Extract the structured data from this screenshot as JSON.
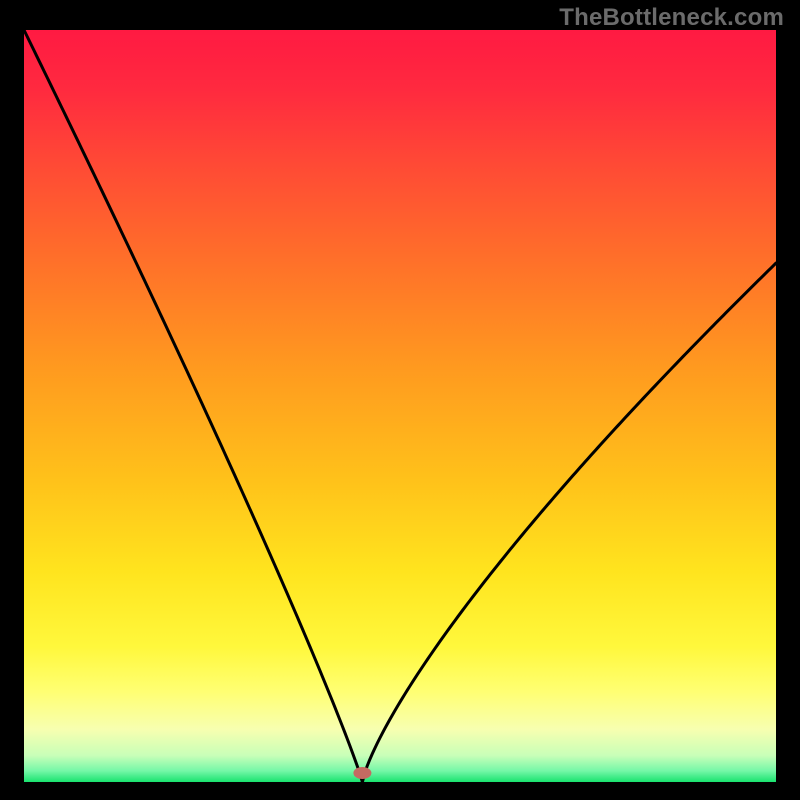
{
  "watermark": "TheBottleneck.com",
  "chart_data": {
    "type": "line",
    "title": "",
    "xlabel": "",
    "ylabel": "",
    "xlim": [
      0,
      100
    ],
    "ylim": [
      0,
      100
    ],
    "optimum_x": 45,
    "marker": {
      "x": 45,
      "y": 1.2,
      "color": "#c46a62",
      "rx": 9,
      "ry": 6
    },
    "gradient_stops": [
      {
        "offset": 0.0,
        "color": "#ff1a42"
      },
      {
        "offset": 0.08,
        "color": "#ff2a3f"
      },
      {
        "offset": 0.18,
        "color": "#ff4a35"
      },
      {
        "offset": 0.3,
        "color": "#ff6e2a"
      },
      {
        "offset": 0.45,
        "color": "#ff9a1f"
      },
      {
        "offset": 0.6,
        "color": "#ffc21a"
      },
      {
        "offset": 0.72,
        "color": "#ffe41e"
      },
      {
        "offset": 0.82,
        "color": "#fff83c"
      },
      {
        "offset": 0.88,
        "color": "#ffff73"
      },
      {
        "offset": 0.93,
        "color": "#f7ffb0"
      },
      {
        "offset": 0.965,
        "color": "#c8ffb8"
      },
      {
        "offset": 0.985,
        "color": "#76f7a8"
      },
      {
        "offset": 1.0,
        "color": "#19e36f"
      }
    ],
    "curve": {
      "description": "V-shaped bottleneck curve; y is deviation from optimum in percent",
      "left_scale": 5.0,
      "right_scale": 1.25,
      "x": [
        0,
        2,
        4,
        6,
        8,
        10,
        12,
        14,
        16,
        18,
        20,
        22,
        24,
        26,
        28,
        30,
        32,
        34,
        36,
        38,
        40,
        41,
        42,
        43,
        44,
        45,
        46,
        47,
        48,
        50,
        52,
        54,
        56,
        58,
        60,
        62,
        64,
        66,
        68,
        70,
        72,
        74,
        76,
        78,
        80,
        82,
        84,
        86,
        88,
        90,
        92,
        94,
        96,
        98,
        100
      ],
      "y": [
        100,
        95.45,
        90.91,
        86.36,
        81.82,
        77.27,
        72.73,
        68.18,
        63.64,
        59.09,
        54.55,
        50.0,
        45.45,
        40.91,
        36.36,
        31.82,
        27.27,
        22.73,
        18.18,
        13.64,
        9.09,
        7.27,
        5.45,
        3.64,
        1.82,
        0.0,
        1.25,
        2.5,
        3.75,
        6.25,
        8.75,
        11.25,
        13.75,
        16.25,
        18.75,
        21.25,
        23.75,
        26.25,
        28.75,
        31.25,
        33.75,
        36.25,
        38.75,
        41.25,
        43.75,
        46.25,
        48.75,
        51.25,
        53.75,
        56.25,
        58.75,
        61.25,
        63.75,
        66.25,
        68.75
      ]
    }
  }
}
